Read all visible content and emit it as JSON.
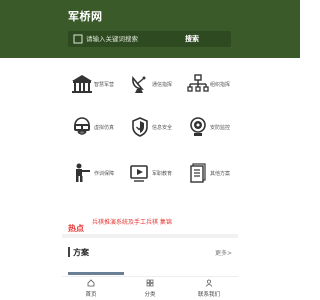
{
  "header": {
    "brand": "军桥网",
    "search": {
      "placeholder": "请输入关键词搜索",
      "button_label": "搜索"
    }
  },
  "categories": [
    {
      "label": "智慧军营",
      "icon": "barracks-icon"
    },
    {
      "label": "通信指挥",
      "icon": "satellite-dish-icon"
    },
    {
      "label": "组织指挥",
      "icon": "network-hierarchy-icon"
    },
    {
      "label": "虚拟仿真",
      "icon": "vr-headset-icon"
    },
    {
      "label": "信息安全",
      "icon": "shield-icon"
    },
    {
      "label": "安防监控",
      "icon": "camera-icon"
    },
    {
      "label": "作训保障",
      "icon": "soldier-icon"
    },
    {
      "label": "军职教育",
      "icon": "video-play-icon"
    },
    {
      "label": "其他方案",
      "icon": "document-icon"
    }
  ],
  "hot": {
    "label": "热点",
    "text": "兵棋推演系统及手工兵棋 集锦"
  },
  "section": {
    "title": "方案",
    "more": "更多>"
  },
  "tabbar": [
    {
      "label": "首页",
      "icon": "home-icon"
    },
    {
      "label": "分类",
      "icon": "category-icon"
    },
    {
      "label": "联系我们",
      "icon": "contact-icon"
    }
  ],
  "colors": {
    "header": "#3a5a2a",
    "hot": "#e53935",
    "icons": "#333333"
  }
}
